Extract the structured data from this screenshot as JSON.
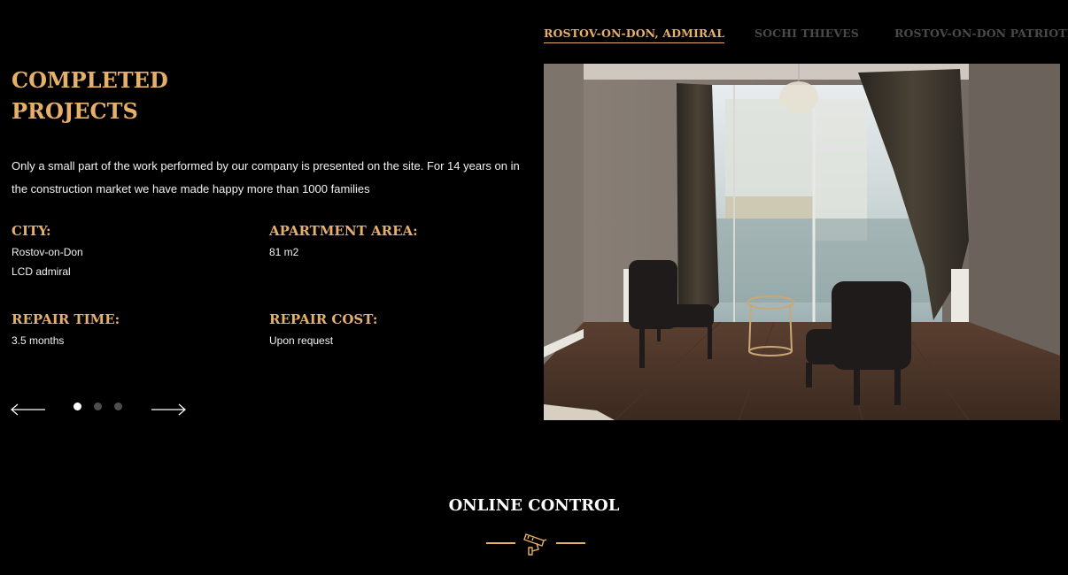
{
  "tabs": [
    {
      "label": "ROSTOV-ON-DON, ADMIRAL",
      "active": true
    },
    {
      "label": "SOCHI THIEVES",
      "active": false
    },
    {
      "label": "ROSTOV-ON-DON PATRIOTIC",
      "active": false
    }
  ],
  "heading": {
    "line1": "COMPLETED",
    "line2": "PROJECTS"
  },
  "intro": "Only a small part of the work performed by our company is presented on the site. For 14 years on in the construction market we have made happy more than 1000 families",
  "specs": {
    "city": {
      "label": "CITY:",
      "value1": "Rostov-on-Don",
      "value2": "LCD admiral"
    },
    "area": {
      "label": "APARTMENT AREA:",
      "value": "81 m2"
    },
    "time": {
      "label": "REPAIR TIME:",
      "value": "3.5 months"
    },
    "cost": {
      "label": "REPAIR COST:",
      "value": "Upon request"
    }
  },
  "slider": {
    "slide_count": 3,
    "active_index": 0
  },
  "online_control": {
    "title": "ONLINE CONTROL"
  },
  "icons": {
    "prev": "arrow-left-icon",
    "next": "arrow-right-icon",
    "camera": "security-camera-icon"
  },
  "colors": {
    "accent": "#e6b06a",
    "background": "#000000",
    "inactive_tab": "#4a4a4a"
  }
}
